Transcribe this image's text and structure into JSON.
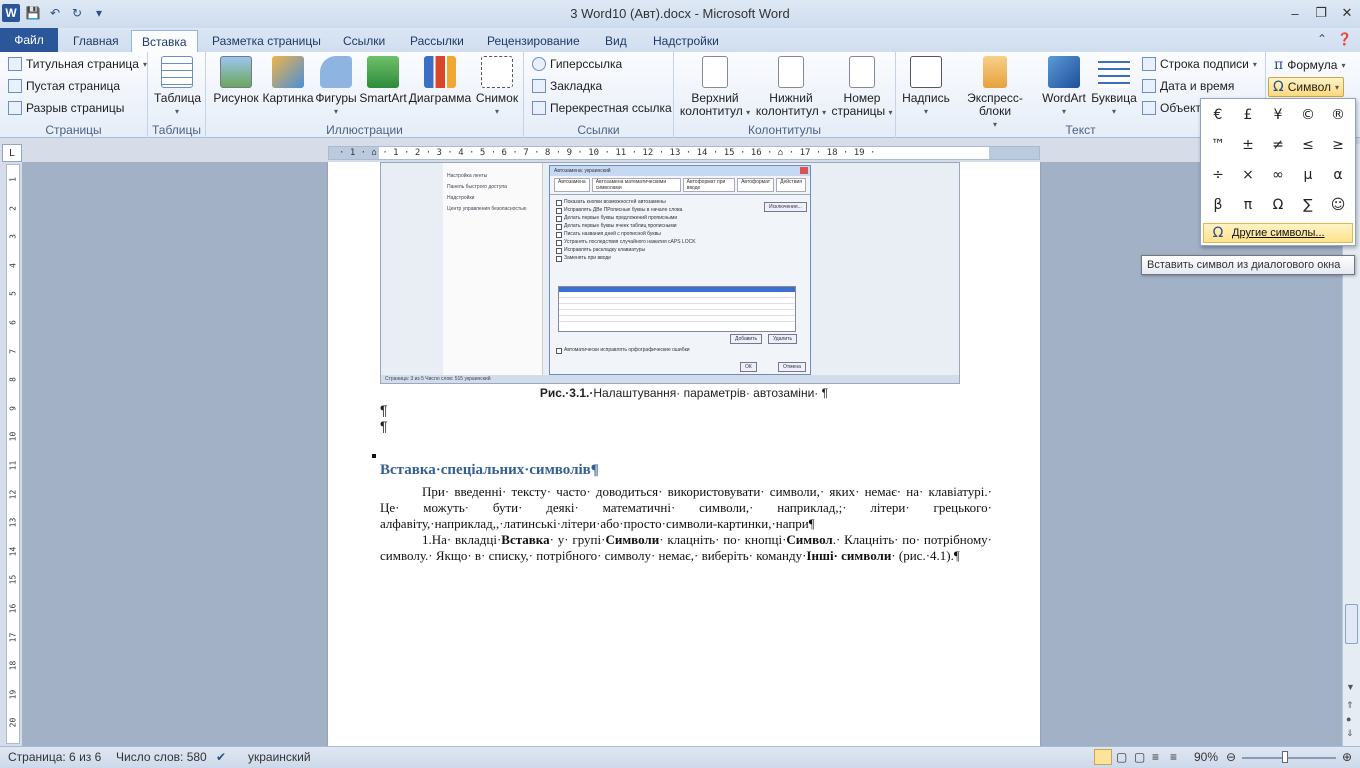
{
  "titlebar": {
    "title": "3 Word10  (Авт).docx - Microsoft Word",
    "app_logo": "W",
    "minimize": "–",
    "maximize": "❐",
    "close": "✕"
  },
  "tabs": {
    "file": "Файл",
    "home": "Главная",
    "insert": "Вставка",
    "layout": "Разметка страницы",
    "references": "Ссылки",
    "mailings": "Рассылки",
    "review": "Рецензирование",
    "view": "Вид",
    "addins": "Надстройки"
  },
  "ribbon": {
    "pages": {
      "cover": "Титульная страница",
      "blank": "Пустая страница",
      "break": "Разрыв страницы",
      "label": "Страницы"
    },
    "tables": {
      "table": "Таблица",
      "label": "Таблицы"
    },
    "illustrations": {
      "picture": "Рисунок",
      "clipart": "Картинка",
      "shapes": "Фигуры",
      "smartart": "SmartArt",
      "chart": "Диаграмма",
      "screenshot": "Снимок",
      "label": "Иллюстрации"
    },
    "links": {
      "hyperlink": "Гиперссылка",
      "bookmark": "Закладка",
      "crossref": "Перекрестная ссылка",
      "label": "Ссылки"
    },
    "headerfooter": {
      "header1": "Верхний",
      "header2": "колонтитул",
      "footer1": "Нижний",
      "footer2": "колонтитул",
      "pagenum1": "Номер",
      "pagenum2": "страницы",
      "label": "Колонтитулы"
    },
    "text": {
      "textbox": "Надпись",
      "quickparts": "Экспресс-блоки",
      "wordart": "WordArt",
      "dropcap": "Буквица",
      "sigline": "Строка подписи",
      "datetime": "Дата и время",
      "object": "Объект",
      "label": "Текст"
    },
    "symbols": {
      "formula": "Формула",
      "symbol": "Символ"
    }
  },
  "symbol_panel": {
    "symbols": [
      "€",
      "£",
      "¥",
      "©",
      "®",
      "™",
      "±",
      "≠",
      "≤",
      "≥",
      "÷",
      "×",
      "∞",
      "µ",
      "α",
      "β",
      "π",
      "Ω",
      "∑",
      "☺"
    ],
    "more_label": "Другие символы...",
    "more_icon": "Ω",
    "tooltip": "Вставить символ из диалогового окна"
  },
  "ruler": {
    "marks": "· 1 · ⌂ · 1 · 2 · 3 · 4 · 5 · 6 · 7 · 8 · 9 · 10 · 11 · 12 · 13 · 14 · 15 · 16 · ⌂ · 17 · 18 · 19 ·",
    "vmarks": [
      "1",
      "2",
      "3",
      "4",
      "5",
      "6",
      "7",
      "8",
      "9",
      "10",
      "11",
      "12",
      "13",
      "14",
      "15",
      "16",
      "17",
      "18",
      "19",
      "20"
    ]
  },
  "figure": {
    "left_items": [
      "Настройка ленты",
      "Панель быстрого доступа",
      "Надстройки",
      "Центр управления безопасностью"
    ],
    "dialog_title": "Автозамена: украинский",
    "dialog_tabs": [
      "Автозамена",
      "Автозамена математическими символами",
      "Автоформат при вводе",
      "Автоформат",
      "Действия"
    ],
    "options": [
      "Показать кнопки возможностей автозамены",
      "Исправлять ДВе ПРописные буквы в начале слова",
      "Делать первые буквы предложений прописными",
      "Делать первые буквы ячеек таблиц прописными",
      "Писать названия дней с прописной буквы",
      "Устранять последствия случайного нажатия cAPS LOCK",
      "Исправлять раскладку клавиатуры",
      "Заменять при вводе"
    ],
    "exceptions_btn": "Исключения...",
    "add_btn": "Добавить",
    "delete_btn": "Удалить",
    "spell_option": "Автоматически исправлять орфографические ошибки",
    "ok_btn": "ОК",
    "cancel_btn": "Отмена",
    "status": "Страница: 3 из 5    Число слов: 515    украинский"
  },
  "document": {
    "caption_bold": "Рис.·3.1.·",
    "caption_text": "Налаштування· параметрів· автозаміни· ¶",
    "pilcrow": "¶",
    "heading": "Вставка·спеціальних·символів¶",
    "para1": "При· введенні· тексту· часто· доводиться· використовувати· символи,· яких· немає· на· клавіатурі.· Це· можуть· бути· деякі· математичні· символи,· наприклад,;· літери· грецького· алфавіту,·наприклад,,·латинські·літери·або·просто·символи-картинки,·напри¶",
    "para2_a": "1.На· вкладці·",
    "para2_b": "Вставка",
    "para2_c": "· у· групі·",
    "para2_d": "Символи",
    "para2_e": "· клацніть· по· кнопці·",
    "para2_f": "Символ",
    "para2_g": ".· Клацніть· по· потрібному· символу.· Якщо· в· списку,· потрібного· символу· немає,· виберіть· команду·",
    "para2_h": "Інші· символи",
    "para2_i": "· (рис.·4.1).¶"
  },
  "statusbar": {
    "page": "Страница: 6 из 6",
    "words": "Число слов: 580",
    "lang": "украинский",
    "zoom": "90%"
  }
}
